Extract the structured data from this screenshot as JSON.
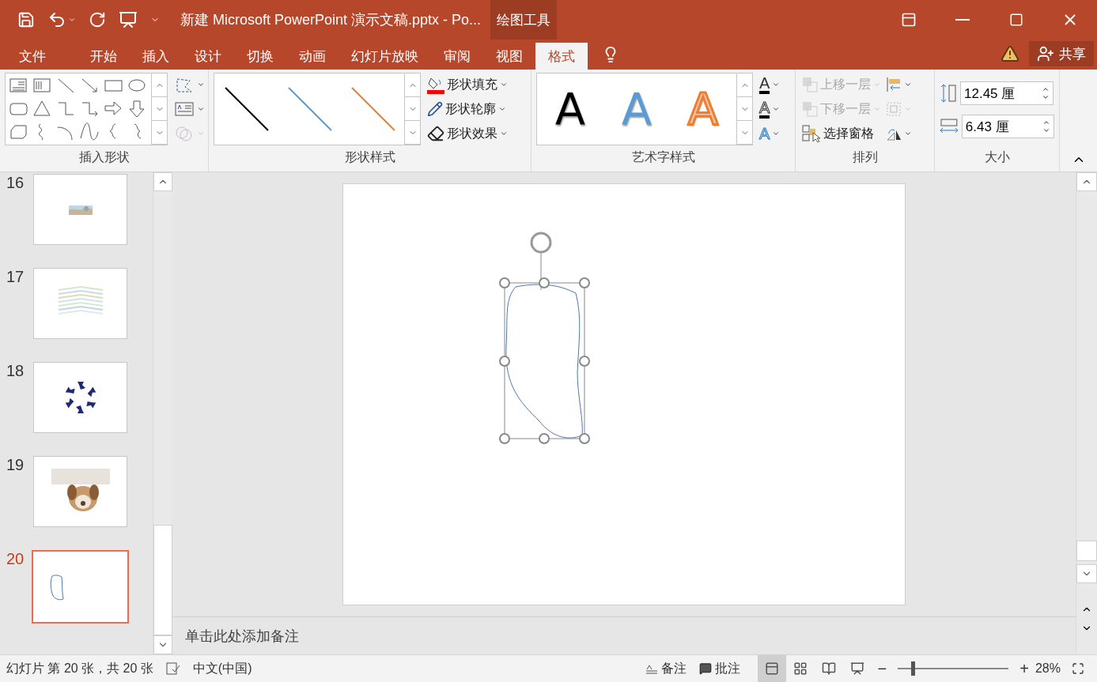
{
  "title_bar": {
    "title": "新建 Microsoft PowerPoint 演示文稿.pptx - Po...",
    "context_tab": "绘图工具"
  },
  "tabs": [
    {
      "label": "文件",
      "selected": false
    },
    {
      "label": "开始",
      "selected": false
    },
    {
      "label": "插入",
      "selected": false
    },
    {
      "label": "设计",
      "selected": false
    },
    {
      "label": "切换",
      "selected": false
    },
    {
      "label": "动画",
      "selected": false
    },
    {
      "label": "幻灯片放映",
      "selected": false
    },
    {
      "label": "审阅",
      "selected": false
    },
    {
      "label": "视图",
      "selected": false
    },
    {
      "label": "格式",
      "selected": true
    }
  ],
  "share": {
    "label": "共享"
  },
  "ribbon": {
    "insert_shapes": {
      "label": "插入形状"
    },
    "shape_styles": {
      "label": "形状样式",
      "buttons": [
        "形状填充",
        "形状轮廓",
        "形状效果"
      ]
    },
    "wordart_styles": {
      "label": "艺术字样式",
      "samples": [
        "A",
        "A",
        "A"
      ],
      "text_fill_glyph": "A",
      "text_outline_glyph": "A",
      "text_effect_glyph": "A"
    },
    "arrange": {
      "label": "排列",
      "buttons": [
        {
          "label": "上移一层",
          "disabled": true
        },
        {
          "label": "下移一层",
          "disabled": true
        },
        {
          "label": "选择窗格",
          "disabled": false
        }
      ]
    },
    "size": {
      "label": "大小",
      "height": "12.45 厘",
      "width": "6.43 厘"
    }
  },
  "slides": [
    {
      "number": "16",
      "kind": "strip",
      "selected": false
    },
    {
      "number": "17",
      "kind": "pattern",
      "selected": false
    },
    {
      "number": "18",
      "kind": "arrows",
      "selected": false
    },
    {
      "number": "19",
      "selected": false
    },
    {
      "number": "20",
      "kind": "shape",
      "selected": true
    }
  ],
  "notes": {
    "placeholder": "单击此处添加备注"
  },
  "status_bar": {
    "slide_info": "幻灯片 第 20 张，共 20 张",
    "language": "中文(中国)",
    "notes_button": "备注",
    "comments_button": "批注",
    "views": [
      {
        "selected": true
      },
      {
        "selected": false
      },
      {
        "selected": false
      },
      {
        "selected": false
      }
    ],
    "zoom_minus": "−",
    "zoom_plus": "+",
    "zoom": {
      "level": 0.12
    },
    "zoom_percent": "28%"
  }
}
